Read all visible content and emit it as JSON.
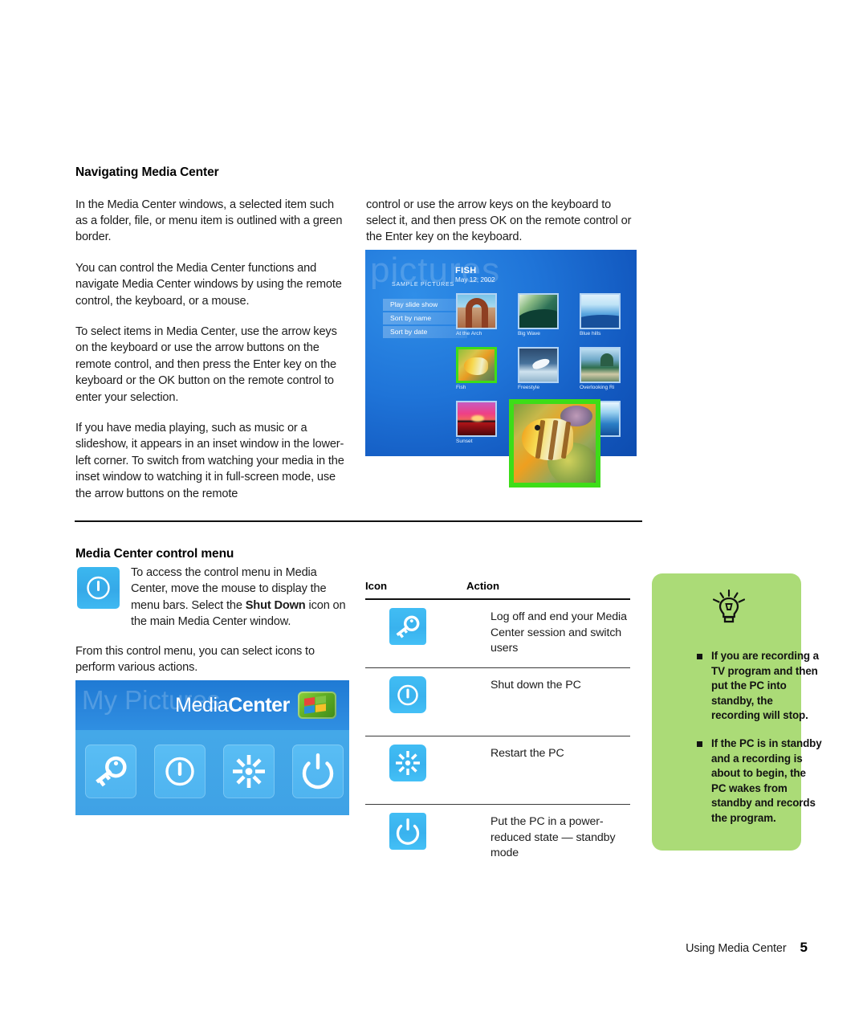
{
  "document": {
    "footer_text": "Using Media Center",
    "page_number": "5"
  },
  "section_navigating": {
    "heading": "Navigating Media Center",
    "left_paragraphs": [
      "In the Media Center windows, a selected item such as a folder, file, or menu item is outlined with a green border.",
      "You can control the Media Center functions and navigate Media Center windows by using the remote control, the keyboard, or a mouse.",
      "To select items in Media Center, use the arrow keys on the keyboard or use the arrow buttons on the remote control, and then press the Enter key on the keyboard or the OK button on the remote control to enter your selection.",
      "If you have media playing, such as music or a slideshow, it appears in an inset window in the lower-left corner. To switch from watching your media in the inset window to watching it in full-screen mode, use the arrow buttons on the remote"
    ],
    "right_paragraphs": [
      "control or use the arrow keys on the keyboard to select it, and then press OK on the remote control or the Enter key on the keyboard."
    ]
  },
  "media_center_screenshot": {
    "watermark": "pictures",
    "breadcrumb": "SAMPLE PICTURES",
    "title": "FISH",
    "date": "May 12, 2002",
    "menu_items": [
      {
        "label": "Play slide show",
        "has_dot": false
      },
      {
        "label": "Sort by name",
        "has_dot": true
      },
      {
        "label": "Sort by date",
        "has_dot": false
      }
    ],
    "thumbnails": [
      {
        "caption": "At the Arch",
        "selected": false
      },
      {
        "caption": "Big Wave",
        "selected": false
      },
      {
        "caption": "Blue hills",
        "selected": false
      },
      {
        "caption": "Fish",
        "selected": true
      },
      {
        "caption": "Freestyle",
        "selected": false
      },
      {
        "caption": "Overlooking Ri",
        "selected": false
      },
      {
        "caption": "Sunset",
        "selected": false
      }
    ],
    "selection_border_color": "#3ddd18",
    "inset_window_label": "Fish"
  },
  "section_control_menu": {
    "heading": "Media Center control menu",
    "intro_prefix": "To access the control menu in Media Center, move the mouse to display the menu bars. Select the ",
    "intro_bold": "Shut Down",
    "intro_suffix": " icon on the main Media Center window.",
    "second_paragraph": "From this control menu, you can select icons to perform various actions.",
    "icon_name": "shut-down-icon"
  },
  "media_center_logo_panel": {
    "ghost_text": "My Pictures",
    "brand_light": "Media",
    "brand_bold": "Center",
    "tiles": [
      "key-icon",
      "shut-down-icon",
      "restart-icon",
      "standby-icon"
    ]
  },
  "icon_table": {
    "headers": {
      "icon": "Icon",
      "action": "Action"
    },
    "rows": [
      {
        "icon": "key-icon",
        "action": "Log off and end your Media Center session and switch users"
      },
      {
        "icon": "shut-down-icon",
        "action": "Shut down the PC"
      },
      {
        "icon": "restart-icon",
        "action": "Restart the PC"
      },
      {
        "icon": "standby-icon",
        "action": "Put the PC in a power-reduced state — standby mode"
      }
    ]
  },
  "tip_box": {
    "icon": "lightbulb-icon",
    "background_color": "#abdb77",
    "items": [
      "If you are recording a TV program and then put the PC into standby, the recording will stop.",
      "If the PC is in standby and a recording is about to begin, the PC wakes from standby and records the program."
    ]
  },
  "colors": {
    "icon_blue": "#41bdf4",
    "selection_green": "#3ddd18",
    "tip_green": "#abdb77"
  }
}
